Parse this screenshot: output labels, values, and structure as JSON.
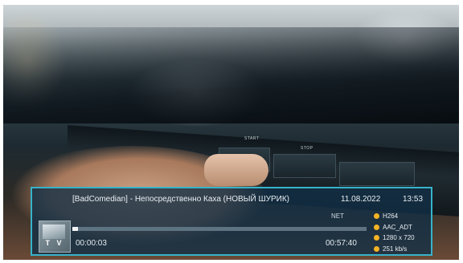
{
  "photo": {
    "keys": [
      "START",
      "STOP"
    ]
  },
  "osd": {
    "title": "[BadComedian] - Непосредственно Каха (НОВЫЙ ШУРИК)",
    "date": "11.08.2022",
    "time": "13:53",
    "source": "NET",
    "channel_logo_text": "T V",
    "position": "00:00:03",
    "duration": "00:57:40",
    "progress_fraction": 0.001,
    "stream_info": [
      "H264",
      "AAC_ADT",
      "1280 x 720",
      "251 kb/s"
    ],
    "colors": {
      "border": "#37b3c9",
      "bullet": "#f5b324"
    }
  }
}
